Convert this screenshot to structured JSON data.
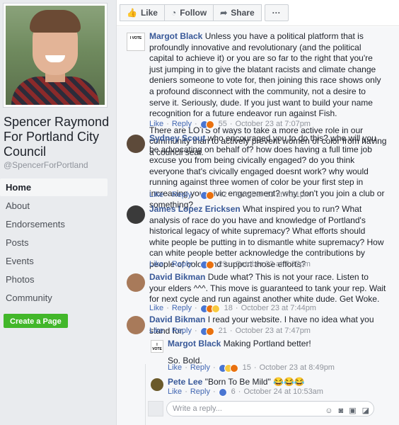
{
  "page": {
    "name": "Spencer Raymond For Portland City Council",
    "handle": "@SpencerForPortland"
  },
  "nav": {
    "items": [
      "Home",
      "About",
      "Endorsements",
      "Posts",
      "Events",
      "Photos",
      "Community"
    ],
    "active": "Home"
  },
  "create_page": "Create a Page",
  "actions": {
    "like": "Like",
    "follow": "Follow",
    "share": "Share",
    "more": "···"
  },
  "labels": {
    "like": "Like",
    "reply": "Reply",
    "dot": "·"
  },
  "comments": [
    {
      "author": "Margot Black",
      "text": "Unless you have a political platform that is profoundly innovative and revolutionary (and the political capital to achieve it) or you are so far to the right that you're just jumping in to give the blatant racists and climate change deniers someone to vote for, then joining this race shows only a profound disconnect with the community, not a desire to serve it. Seriously, dude. If you just want to build your name recognition for a future endeavor run against Fish.",
      "text2": "There are LOTS of ways to take a more active role in our community than to actively prevent women of color from having a council seat.",
      "count": "55",
      "time": "October 23 at 7:07pm"
    },
    {
      "author": "Sydney Scout",
      "text": "who encouraged you to do this? who will you be advocating on behalf of? how does having a full time job excuse you from being civically engaged? do you think everyone that's civically engaged doesnt work? why would running against three women of color be your first step in increasing your civic engagement? why don't you join a club or something?",
      "count": "42",
      "time": "October 23 at 7:21pm"
    },
    {
      "author": "James Lopez Ericksen",
      "text": "What inspired you to run? What analysis of race do you have and knowledge of Portland's historical legacy of white supremacy? What efforts should white people be putting in to dismantle white supremacy? How can white people better acknowledge the contributions by people of color and support those efforts?",
      "count": "29",
      "time": "October 23 at 7:37pm"
    },
    {
      "author": "David Bikman",
      "text": "Dude what? This is not your race. Listen to your elders ^^^. This move is guaranteed to tank your rep. Wait for next cycle and run against another white dude. Get Woke.",
      "count": "18",
      "time": "October 23 at 7:44pm"
    },
    {
      "author": "David Bikman",
      "text": "I read your website. I have no idea what you stand for.",
      "count": "21",
      "time": "October 23 at 7:47pm"
    }
  ],
  "replies": [
    {
      "author": "Margot Black",
      "text": "Making Portland better!",
      "text2": "So. Bold.",
      "count": "15",
      "time": "October 23 at 8:49pm"
    },
    {
      "author": "Pete Lee",
      "text": "\"Born To Be Mild\" 😂😂😂",
      "count": "6",
      "time": "October 24 at 10:53am"
    }
  ],
  "write_reply": {
    "placeholder": "Write a reply...",
    "icons": [
      "emoji-icon",
      "camera-icon",
      "gif-icon",
      "sticker-icon"
    ]
  }
}
